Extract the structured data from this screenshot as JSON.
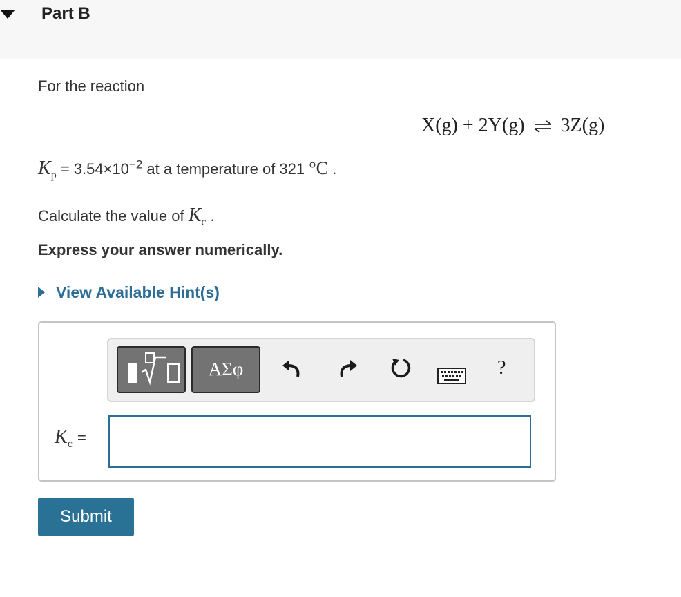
{
  "part": {
    "title": "Part B"
  },
  "intro": "For the reaction",
  "equation": {
    "left": "X(g) + 2Y(g)",
    "right": "3Z(g)"
  },
  "kp_line": {
    "symbol": "K",
    "symbol_sub": "p",
    "equals_value": "= 3.54×10",
    "exponent": "−2",
    "middle": " at a temperature of 321 ",
    "unit": "°C",
    "end": " ."
  },
  "question": {
    "prefix": "Calculate the value of ",
    "symbol": "K",
    "symbol_sub": "c",
    "suffix": " ."
  },
  "instruction": "Express your answer numerically.",
  "hint": {
    "label": "View Available Hint(s)"
  },
  "toolbar": {
    "greek_label": "ΑΣφ",
    "help_label": "?"
  },
  "answer": {
    "symbol": "K",
    "symbol_sub": "c",
    "equals": "=",
    "value": ""
  },
  "submit_label": "Submit",
  "colors": {
    "accent": "#2a7196",
    "link": "#2c6e96",
    "header_bg": "#f7f7f7"
  },
  "icons": [
    "expand-arrow",
    "template-icon",
    "undo-icon",
    "redo-icon",
    "reset-icon",
    "keyboard-icon",
    "help-icon"
  ]
}
